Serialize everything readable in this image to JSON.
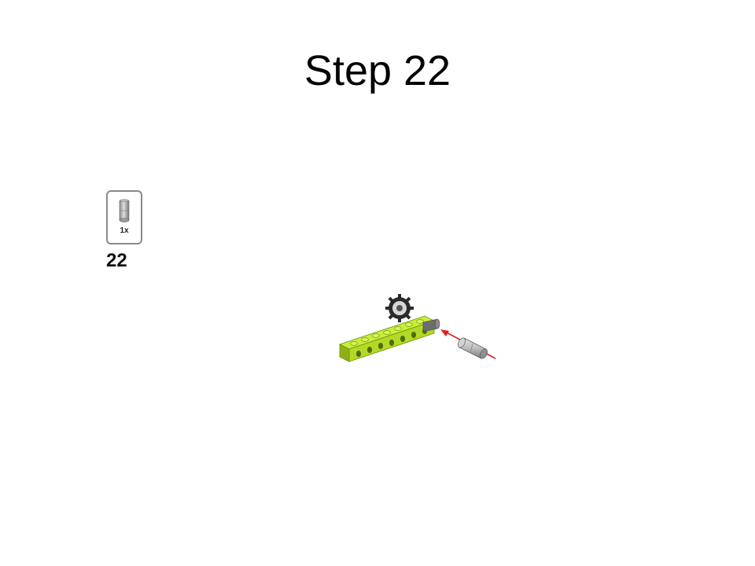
{
  "slide": {
    "title": "Step 22"
  },
  "parts_list": {
    "quantity": "1x",
    "part_icon": "axle-connector-icon"
  },
  "step": {
    "number": "22"
  },
  "colors": {
    "beam": "#b8e02a",
    "beam_dark": "#7fa010",
    "connector": "#b5b5b5",
    "gear": "#2a2a2a",
    "arrow": "#e02020",
    "frame": "#8a8a8a"
  }
}
